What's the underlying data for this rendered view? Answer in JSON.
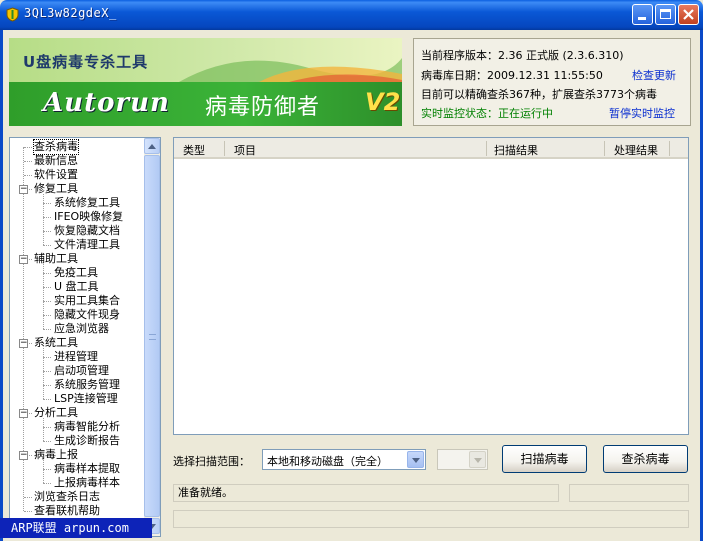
{
  "window": {
    "title": "3QL3w82gdeX_"
  },
  "banner": {
    "title": "U盘病毒专杀工具",
    "logo": "Autorun",
    "subtitle": "病毒防御者",
    "version_badge": "V2"
  },
  "info": {
    "version": "当前程序版本：2.36 正式版 (2.3.6.310)",
    "db_date": "病毒库日期：2009.12.31 11:55:50",
    "check_update": "检查更新",
    "capability": "目前可以精确查杀367种，扩展查杀3773个病毒",
    "monitor_status": "实时监控状态：正在运行中",
    "pause_monitor": "暂停实时监控"
  },
  "tree": {
    "items": [
      {
        "label": "查杀病毒",
        "level": 0,
        "selected": true
      },
      {
        "label": "最新信息",
        "level": 0
      },
      {
        "label": "软件设置",
        "level": 0
      },
      {
        "label": "修复工具",
        "level": 0,
        "expander": "-"
      },
      {
        "label": "系统修复工具",
        "level": 1
      },
      {
        "label": "IFEO映像修复",
        "level": 1
      },
      {
        "label": "恢复隐藏文档",
        "level": 1
      },
      {
        "label": "文件清理工具",
        "level": 1
      },
      {
        "label": "辅助工具",
        "level": 0,
        "expander": "-"
      },
      {
        "label": "免疫工具",
        "level": 1
      },
      {
        "label": "U 盘工具",
        "level": 1
      },
      {
        "label": "实用工具集合",
        "level": 1
      },
      {
        "label": "隐藏文件现身",
        "level": 1
      },
      {
        "label": "应急浏览器",
        "level": 1
      },
      {
        "label": "系统工具",
        "level": 0,
        "expander": "-"
      },
      {
        "label": "进程管理",
        "level": 1
      },
      {
        "label": "启动项管理",
        "level": 1
      },
      {
        "label": "系统服务管理",
        "level": 1
      },
      {
        "label": "LSP连接管理",
        "level": 1
      },
      {
        "label": "分析工具",
        "level": 0,
        "expander": "-"
      },
      {
        "label": "病毒智能分析",
        "level": 1
      },
      {
        "label": "生成诊断报告",
        "level": 1
      },
      {
        "label": "病毒上报",
        "level": 0,
        "expander": "-"
      },
      {
        "label": "病毒样本提取",
        "level": 1
      },
      {
        "label": "上报病毒样本",
        "level": 1
      },
      {
        "label": "浏览查杀日志",
        "level": 0
      },
      {
        "label": "查看联机帮助",
        "level": 0
      }
    ]
  },
  "footer": {
    "arp": "ARP联盟 arpun.com"
  },
  "results": {
    "columns": [
      "类型",
      "项目",
      "扫描结果",
      "处理结果"
    ]
  },
  "scan": {
    "range_label": "选择扫描范围：",
    "range_value": "本地和移动磁盘（完全）",
    "scan_button": "扫描病毒",
    "kill_button": "查杀病毒"
  },
  "status": {
    "text": "准备就绪。"
  },
  "colors": {
    "titlebar": "#0A58D6",
    "link": "#0A2FD0",
    "monitor": "#008000",
    "arp_bg": "#0D23B8"
  }
}
